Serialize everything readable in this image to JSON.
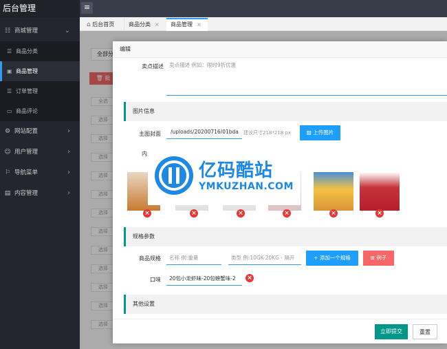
{
  "app": {
    "title": "后台管理"
  },
  "sidebar": {
    "items": [
      {
        "icon": "☷",
        "label": "商城管理"
      },
      {
        "icon": "⚙",
        "label": "网站配置"
      },
      {
        "icon": "☺",
        "label": "用户管理"
      },
      {
        "icon": "⚐",
        "label": "导航菜单"
      },
      {
        "icon": "▤",
        "label": "内容管理"
      }
    ],
    "sub_items": [
      {
        "icon": "☰",
        "label": "商品分类"
      },
      {
        "icon": "▣",
        "label": "商品管理"
      },
      {
        "icon": "☰",
        "label": "订单管理"
      },
      {
        "icon": "▭",
        "label": "商品评论"
      }
    ]
  },
  "topbar": {
    "menu_icon": "≡"
  },
  "tabs": [
    {
      "label": "后台首页"
    },
    {
      "label": "商品分类",
      "close": "×"
    },
    {
      "label": "商品管理",
      "close": "×"
    }
  ],
  "background": {
    "select_label": "全部分",
    "batch_delete": "批",
    "row_labels": [
      "全选",
      "选择",
      "选择",
      "选择",
      "选择",
      "选择",
      "选择",
      "选择",
      "选择",
      "选择",
      "选择",
      "选择",
      "选择"
    ]
  },
  "modal": {
    "title": "编辑",
    "selling_point_label": "卖点描述",
    "selling_point_placeholder": "卖点描述 例如：限时9折优惠",
    "image_section": "图片信息",
    "cover_label": "主图封面",
    "cover_value": "/uploads/20200716/01bda",
    "cover_hint": "建议尺寸218*218 px",
    "upload_button": "上传图片",
    "content_images_label": "内",
    "spec_section": "规格参数",
    "spec_label": "商品规格",
    "spec_name_placeholder": "名称 例:重量",
    "spec_type_placeholder": "类型 例:10GK-20KG - 隔开",
    "add_spec_button": "+ 添加一个规格",
    "example_button": "例子",
    "flavor_label": "口味",
    "flavor_value": "20包小龙虾味-20包螃蟹味-2",
    "other_section": "其他设置",
    "submit_button": "立即提交",
    "reset_button": "重置"
  },
  "watermark": {
    "brand_cn": "亿码酷站",
    "brand_en": "YMKUZHAN.COM"
  },
  "colors": {
    "accent": "#1e9fff",
    "section_border": "#009688",
    "danger": "#e53935",
    "submit": "#009688"
  }
}
